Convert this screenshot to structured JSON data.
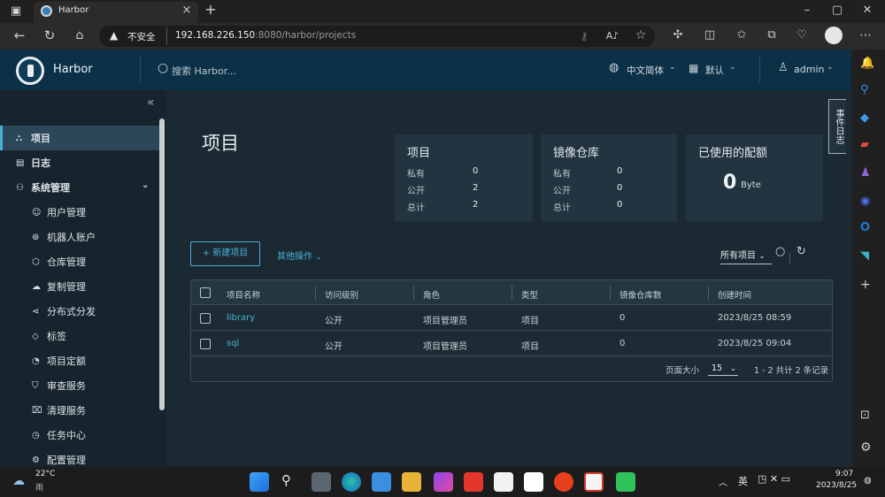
{
  "browser": {
    "tab_title": "Harbor",
    "insecure_label": "不安全",
    "url_host": "192.168.226.150",
    "url_rest": ":8080/harbor/projects",
    "close_glyph": "×",
    "new_tab_glyph": "+"
  },
  "header": {
    "app_name": "Harbor",
    "search_placeholder": "搜索 Harbor...",
    "language": "中文简体",
    "theme": "默认",
    "user": "admin"
  },
  "sidebar": {
    "collapse_glyph": "«",
    "items": [
      {
        "label": "项目",
        "active": true
      },
      {
        "label": "日志"
      },
      {
        "label": "系统管理"
      },
      {
        "label": "用户管理"
      },
      {
        "label": "机器人账户"
      },
      {
        "label": "仓库管理"
      },
      {
        "label": "复制管理"
      },
      {
        "label": "分布式分发"
      },
      {
        "label": "标签"
      },
      {
        "label": "项目定额"
      },
      {
        "label": "审查服务"
      },
      {
        "label": "清理服务"
      },
      {
        "label": "任务中心"
      },
      {
        "label": "配置管理"
      }
    ]
  },
  "events_tab": "事件日志",
  "page": {
    "title": "项目",
    "cards": {
      "projects": {
        "title": "项目",
        "rows": [
          {
            "label": "私有",
            "value": "0"
          },
          {
            "label": "公开",
            "value": "2"
          },
          {
            "label": "总计",
            "value": "2"
          }
        ]
      },
      "repos": {
        "title": "镜像仓库",
        "rows": [
          {
            "label": "私有",
            "value": "0"
          },
          {
            "label": "公开",
            "value": "0"
          },
          {
            "label": "总计",
            "value": "0"
          }
        ]
      },
      "quota": {
        "title": "已使用的配额",
        "value": "0",
        "unit": "Byte"
      }
    },
    "new_project_label": "+ 新建项目",
    "other_actions_label": "其他操作",
    "filter_label": "所有项目"
  },
  "table": {
    "headers": [
      "项目名称",
      "访问级别",
      "角色",
      "类型",
      "镜像仓库数",
      "创建时间"
    ],
    "rows": [
      [
        "library",
        "公开",
        "项目管理员",
        "项目",
        "0",
        "2023/8/25 08:59"
      ],
      [
        "sql",
        "公开",
        "项目管理员",
        "项目",
        "0",
        "2023/8/25 09:04"
      ]
    ],
    "page_size_label": "页面大小",
    "page_size": "15",
    "pagination_text": "1 - 2 共计 2 条记录"
  },
  "taskbar": {
    "temperature": "22°C",
    "weather": "雨",
    "ime": "英",
    "time": "9:07",
    "date": "2023/8/25"
  },
  "colors": {
    "header_bg": "#0c3046",
    "sidebar_bg": "#17242d",
    "main_bg": "#1b2a32",
    "card_bg": "#22343f",
    "accent": "#49afd9",
    "link": "#4aaed9"
  }
}
